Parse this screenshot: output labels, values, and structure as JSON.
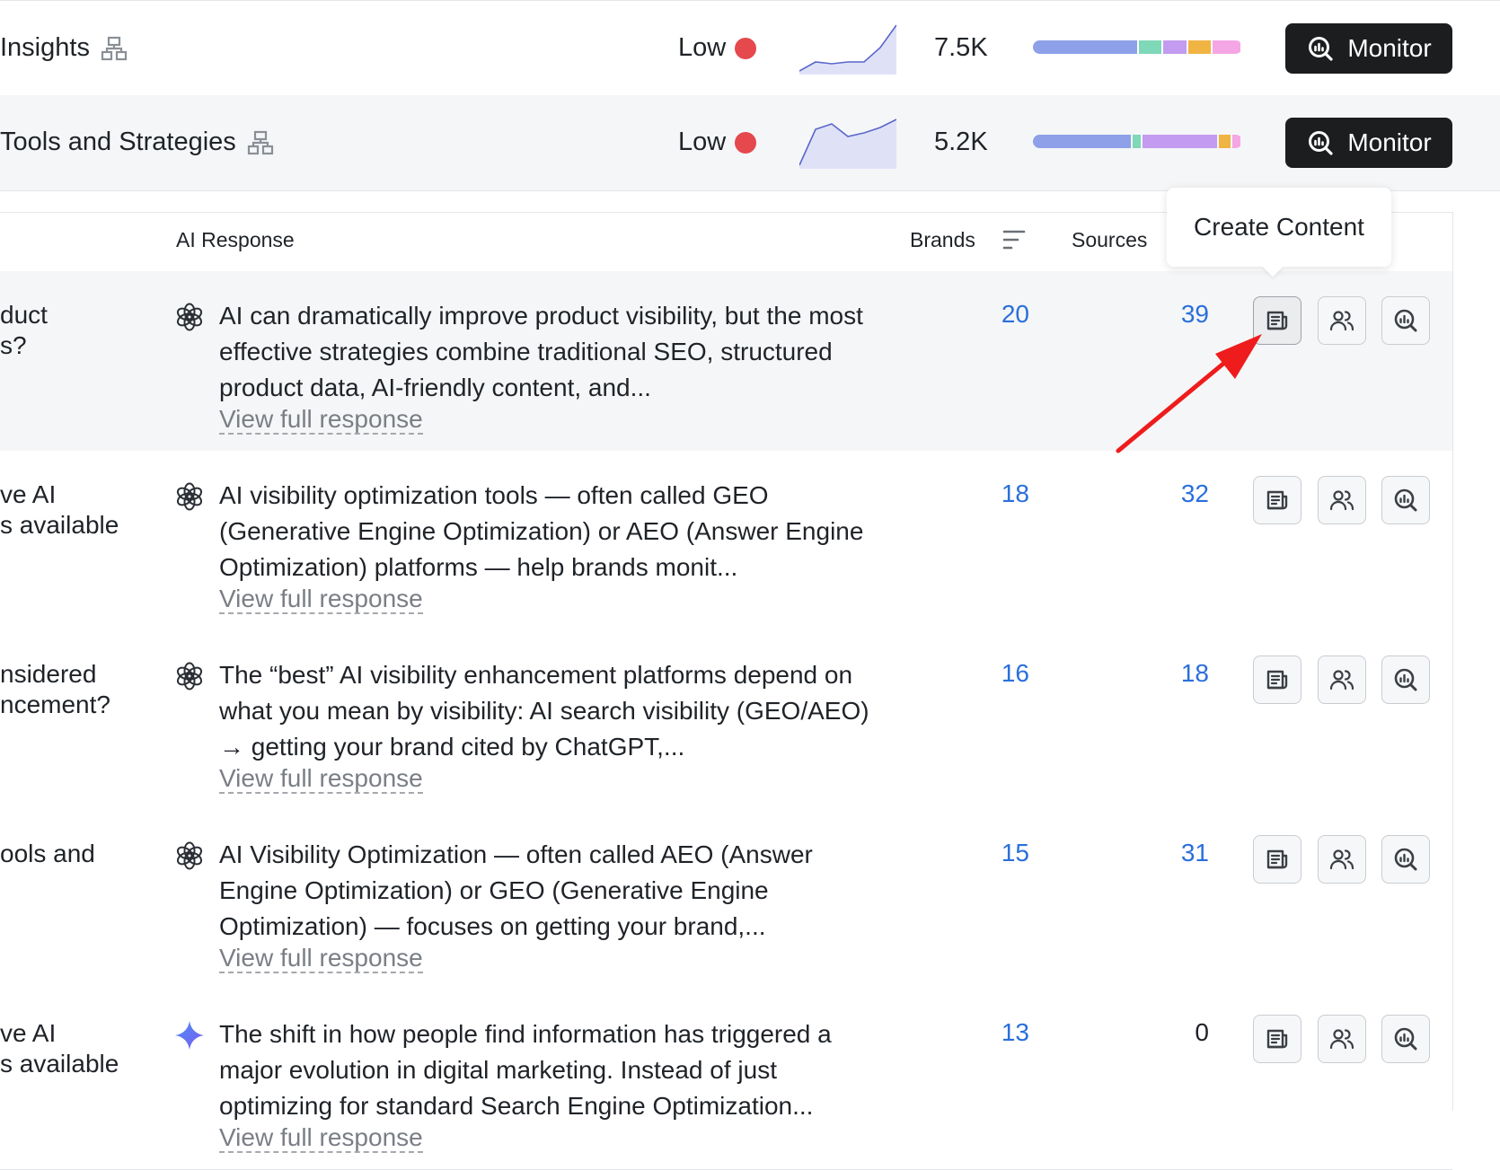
{
  "topics": [
    {
      "title": "Insights",
      "volume_label": "Low",
      "metric": "7.5K",
      "trend": [
        4,
        14,
        12,
        14,
        14,
        30,
        55
      ],
      "bar_segments": [
        {
          "color": "#8da0e8",
          "fraction": 0.52
        },
        {
          "color": "#7fd8b8",
          "fraction": 0.11
        },
        {
          "color": "#c39bf0",
          "fraction": 0.12
        },
        {
          "color": "#f0b443",
          "fraction": 0.11
        },
        {
          "color": "#f5a6e5",
          "fraction": 0.14
        }
      ],
      "monitor_label": "Monitor"
    },
    {
      "title": "Tools and Strategies",
      "volume_label": "Low",
      "metric": "5.2K",
      "trend": [
        4,
        44,
        50,
        36,
        40,
        46,
        55
      ],
      "bar_segments": [
        {
          "color": "#8da0e8",
          "fraction": 0.49
        },
        {
          "color": "#7fd8b8",
          "fraction": 0.04
        },
        {
          "color": "#c39bf0",
          "fraction": 0.37
        },
        {
          "color": "#f0b443",
          "fraction": 0.06
        },
        {
          "color": "#f5a6e5",
          "fraction": 0.04
        }
      ],
      "monitor_label": "Monitor"
    }
  ],
  "table": {
    "headers": {
      "ai_response": "AI Response",
      "brands": "Brands",
      "sources": "Sources"
    },
    "tooltip": "Create Content",
    "view_full_label": "View full response",
    "rows": [
      {
        "prompt_fragment": "duct\ns?",
        "model": "chatgpt-icon",
        "response": "AI can dramatically improve product visibility, but the most effective strategies combine traditional SEO, structured product data, AI-friendly content, and...",
        "brands": "20",
        "sources": "39"
      },
      {
        "prompt_fragment": "ve AI\ns available",
        "model": "chatgpt-icon",
        "response": "AI visibility optimization tools — often called GEO (Generative Engine Optimization) or AEO (Answer Engine Optimization) platforms — help brands monit...",
        "brands": "18",
        "sources": "32"
      },
      {
        "prompt_fragment": "nsidered\nncement?",
        "model": "chatgpt-icon",
        "response": "The “best” AI visibility enhancement platforms depend on what you mean by visibility: AI search visibility (GEO/AEO) → getting your brand cited by ChatGPT,...",
        "brands": "16",
        "sources": "18"
      },
      {
        "prompt_fragment": "ools and",
        "model": "chatgpt-icon",
        "response": "AI Visibility Optimization — often called AEO (Answer Engine Optimization) or GEO (Generative Engine Optimization) — focuses on getting your brand,...",
        "brands": "15",
        "sources": "31"
      },
      {
        "prompt_fragment": "ve AI\ns available",
        "model": "gemini-icon",
        "response": "The shift in how people find information has triggered a major evolution in digital marketing. Instead of just optimizing for standard Search Engine Optimization...",
        "brands": "13",
        "sources": "0"
      }
    ]
  },
  "colors": {
    "accent_blue": "#2a6fdb",
    "red_dot": "#e5484d",
    "annotation_red": "#ee1c1c",
    "monitor_bg": "#1c1d1f"
  }
}
